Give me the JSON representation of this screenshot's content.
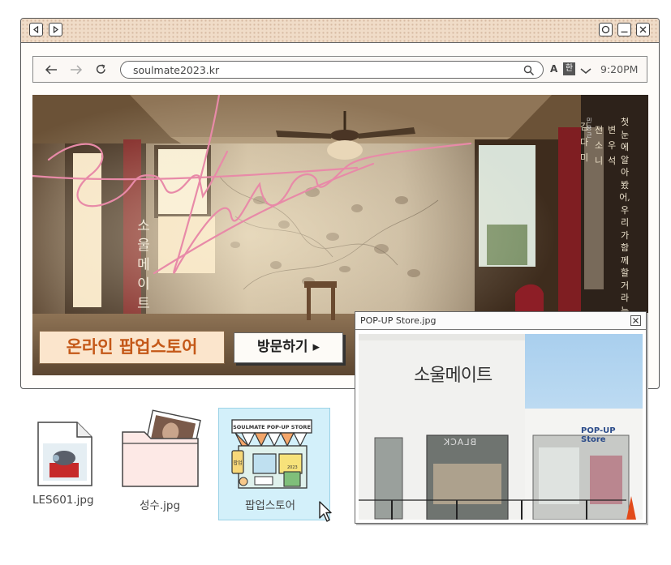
{
  "browser": {
    "url": "soulmate2023.kr",
    "lang_a": "A",
    "lang_han": "한",
    "time": "9:20PM"
  },
  "banner": {
    "title_script": "Soul mate",
    "title_korean": "소울메이트",
    "cast": [
      "김다미",
      "전소니",
      "변우석"
    ],
    "director": "민용근",
    "tagline": "첫눈에 알아봤어, 우리가 함께할 거라는 걸",
    "popup_label": "온라인 팝업스토어",
    "visit_button": "방문하기 ▸"
  },
  "viewer": {
    "title": "POP-UP Store.jpg",
    "sign": "소울메이트",
    "store_label": "POP-UP Store",
    "black_label": "BLACK"
  },
  "desktop": {
    "files": [
      {
        "label": "LES601.jpg"
      },
      {
        "label": "성수.jpg"
      },
      {
        "label": "팝업스토어"
      }
    ],
    "store_icon_header": "SOULMATE POP-UP STORE",
    "store_icon_side": "팝업",
    "store_icon_year": "2023"
  },
  "colors": {
    "titlebar": "#f0dcc8",
    "popup_orange": "#c45818",
    "selection": "#d3f0fa",
    "script_pink": "#e88aa8"
  }
}
